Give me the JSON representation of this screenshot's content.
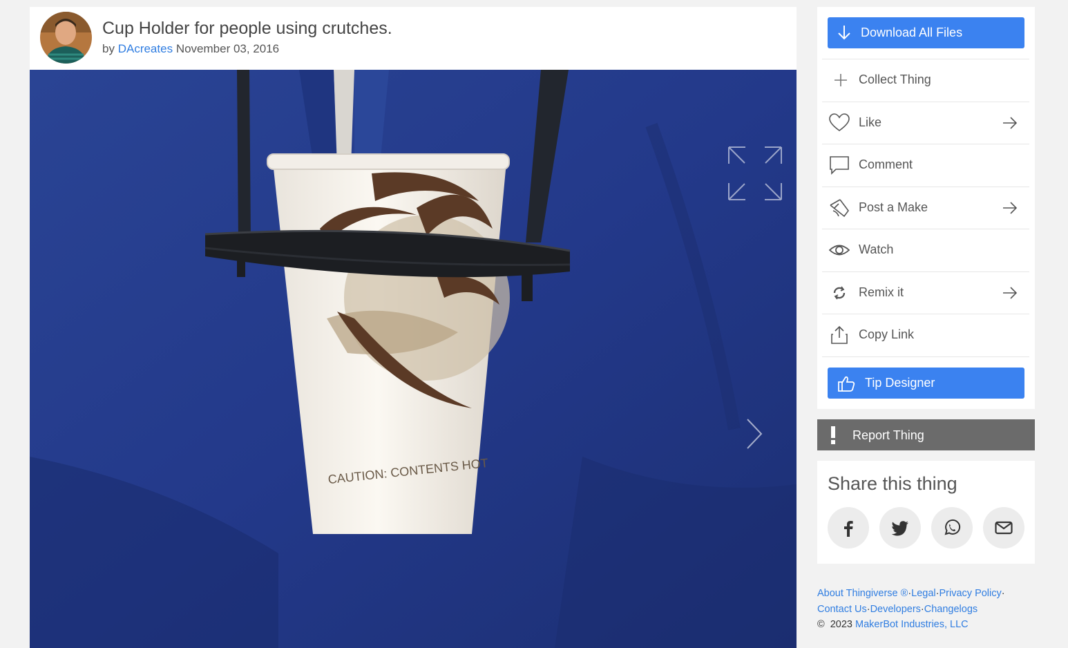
{
  "thing": {
    "title": "Cup Holder for people using crutches.",
    "by_prefix": "by",
    "author": "DAcreates",
    "date": "November 03, 2016"
  },
  "photo": {
    "cup_caption": "CAUTION: CONTENTS HOT"
  },
  "actions": {
    "download_label": "Download All Files",
    "collect_label": "Collect Thing",
    "like_label": "Like",
    "comment_label": "Comment",
    "post_make_label": "Post a Make",
    "watch_label": "Watch",
    "remix_label": "Remix it",
    "copy_link_label": "Copy Link",
    "tip_label": "Tip Designer"
  },
  "report": {
    "label": "Report Thing"
  },
  "share": {
    "title": "Share this thing",
    "buttons": [
      "facebook-icon",
      "twitter-icon",
      "whatsapp-icon",
      "email-icon"
    ]
  },
  "footer": {
    "about": "About Thingiverse ®",
    "legal": "Legal",
    "privacy": "Privacy Policy",
    "contact": "Contact Us",
    "developers": "Developers",
    "changelogs": "Changelogs",
    "sep": "·",
    "copyright": "©  2023",
    "company": "MakerBot Industries, LLC"
  },
  "colors": {
    "accent_blue": "#3b82f0",
    "link_blue": "#2f7de1",
    "report_gray": "#6b6b6b",
    "page_bg": "#f2f2f2"
  }
}
